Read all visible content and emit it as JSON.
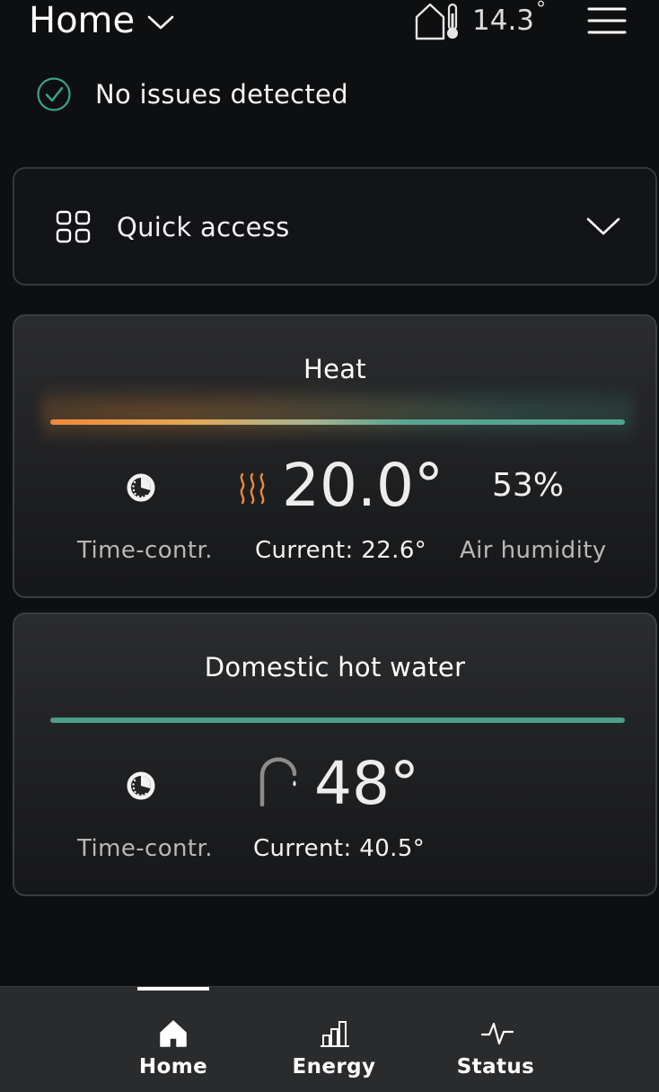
{
  "header": {
    "title": "Home",
    "outdoor_temp": "14.3",
    "outdoor_unit": "°",
    "icons": [
      "chevron-down-icon",
      "house-thermometer-icon",
      "hamburger-menu-icon"
    ]
  },
  "status": {
    "text": "No issues detected",
    "icon": "check-circle-icon",
    "color": "#3aa58a"
  },
  "quick_access": {
    "label": "Quick access",
    "icon": "grid-icon",
    "expand_icon": "chevron-down-icon"
  },
  "heat": {
    "title": "Heat",
    "mode_label": "Time-contr.",
    "setpoint": "20.0°",
    "current": "Current: 22.6°",
    "humidity_value": "53%",
    "humidity_label": "Air humidity",
    "colors": {
      "warm": "#f0893a",
      "cool": "#4fa391"
    },
    "icons": [
      "clock-icon",
      "heat-waves-icon"
    ]
  },
  "hot_water": {
    "title": "Domestic hot water",
    "mode_label": "Time-contr.",
    "setpoint": "48°",
    "current": "Current: 40.5°",
    "colors": {
      "bar": "#4c9d8a"
    },
    "icons": [
      "clock-icon",
      "faucet-icon"
    ]
  },
  "nav": {
    "items": [
      {
        "label": "Home",
        "icon": "home-icon",
        "active": true
      },
      {
        "label": "Energy",
        "icon": "bar-chart-icon",
        "active": false
      },
      {
        "label": "Status",
        "icon": "pulse-icon",
        "active": false
      }
    ]
  }
}
